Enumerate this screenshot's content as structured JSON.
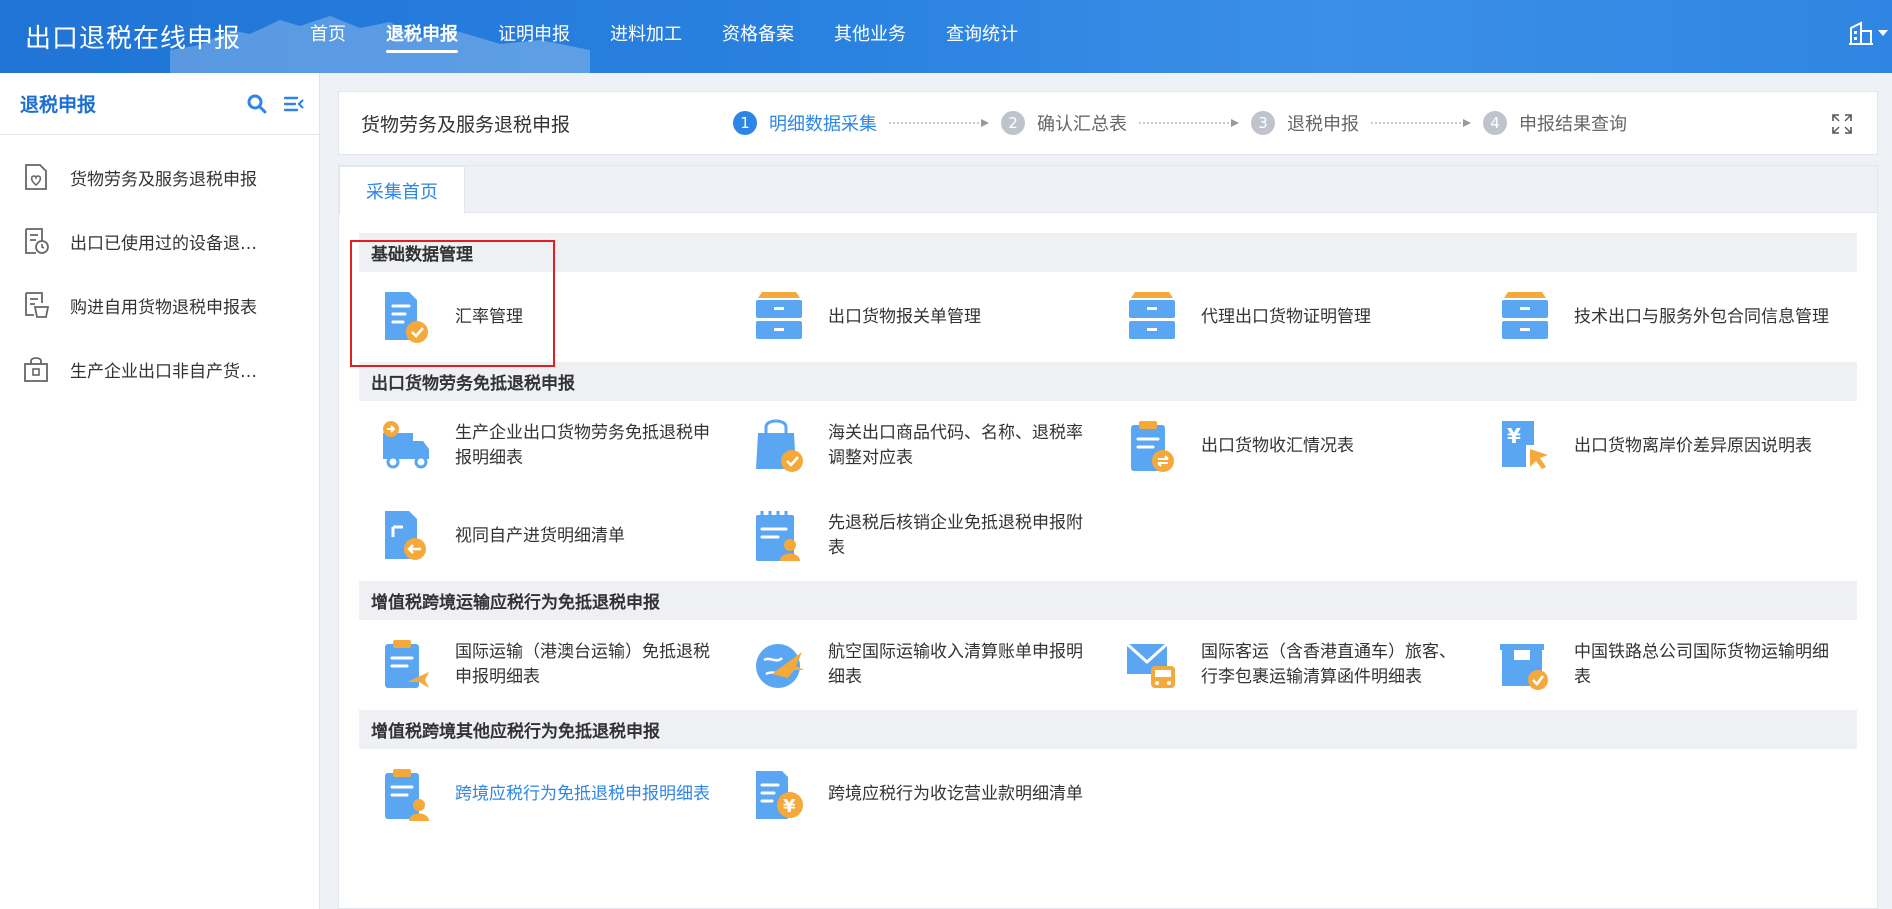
{
  "app": {
    "title": "出口退税在线申报",
    "nav": [
      {
        "label": "首页",
        "active": false
      },
      {
        "label": "退税申报",
        "active": true
      },
      {
        "label": "证明申报",
        "active": false
      },
      {
        "label": "进料加工",
        "active": false
      },
      {
        "label": "资格备案",
        "active": false
      },
      {
        "label": "其他业务",
        "active": false
      },
      {
        "label": "查询统计",
        "active": false
      }
    ],
    "user_icon": "building-icon"
  },
  "sidebar": {
    "title": "退税申报",
    "items": [
      {
        "label": "货物劳务及服务退税申报",
        "icon": "document-heart-icon"
      },
      {
        "label": "出口已使用过的设备退…",
        "icon": "document-clock-icon"
      },
      {
        "label": "购进自用货物退税申报表",
        "icon": "document-basket-icon"
      },
      {
        "label": "生产企业出口非自产货…",
        "icon": "bag-icon"
      }
    ]
  },
  "steps": {
    "title": "货物劳务及服务退税申报",
    "items": [
      {
        "num": "1",
        "label": "明细数据采集",
        "active": true
      },
      {
        "num": "2",
        "label": "确认汇总表",
        "active": false
      },
      {
        "num": "3",
        "label": "退税申报",
        "active": false
      },
      {
        "num": "4",
        "label": "申报结果查询",
        "active": false
      }
    ]
  },
  "tab": {
    "label": "采集首页"
  },
  "sections": [
    {
      "title": "基础数据管理",
      "cards": [
        {
          "label": "汇率管理",
          "icon": "doc-check-icon"
        },
        {
          "label": "出口货物报关单管理",
          "icon": "cabinet-icon"
        },
        {
          "label": "代理出口货物证明管理",
          "icon": "cabinet-icon"
        },
        {
          "label": "技术出口与服务外包合同信息管理",
          "icon": "cabinet-icon"
        }
      ]
    },
    {
      "title": "出口货物劳务免抵退税申报",
      "cards": [
        {
          "label": "生产企业出口货物劳务免抵退税申报明细表",
          "icon": "truck-icon"
        },
        {
          "label": "海关出口商品代码、名称、退税率调整对应表",
          "icon": "shopping-bag-icon"
        },
        {
          "label": "出口货物收汇情况表",
          "icon": "clipboard-exchange-icon"
        },
        {
          "label": "出口货物离岸价差异原因说明表",
          "icon": "yen-cursor-icon"
        },
        {
          "label": "视同自产进货明细清单",
          "icon": "doc-arrow-icon"
        },
        {
          "label": "先退税后核销企业免抵退税申报附表",
          "icon": "calendar-user-icon"
        }
      ]
    },
    {
      "title": "增值税跨境运输应税行为免抵退税申报",
      "cards": [
        {
          "label": "国际运输（港澳台运输）免抵退税申报明细表",
          "icon": "clipboard-plane-icon"
        },
        {
          "label": "航空国际运输收入清算账单申报明细表",
          "icon": "globe-plane-icon"
        },
        {
          "label": "国际客运（含香港直通车）旅客、行李包裹运输清算函件明细表",
          "icon": "mail-bus-icon"
        },
        {
          "label": "中国铁路总公司国际货物运输明细表",
          "icon": "box-check-icon"
        }
      ]
    },
    {
      "title": "增值税跨境其他应税行为免抵退税申报",
      "cards": [
        {
          "label": "跨境应税行为免抵退税申报明细表",
          "icon": "clipboard-user-icon",
          "link": true
        },
        {
          "label": "跨境应税行为收讫营业款明细清单",
          "icon": "doc-yen-icon"
        }
      ]
    }
  ],
  "colors": {
    "accent": "#2d86e6",
    "icon_blue": "#5aa6f2",
    "icon_orange": "#f6a93b",
    "highlight": "#e02020"
  }
}
